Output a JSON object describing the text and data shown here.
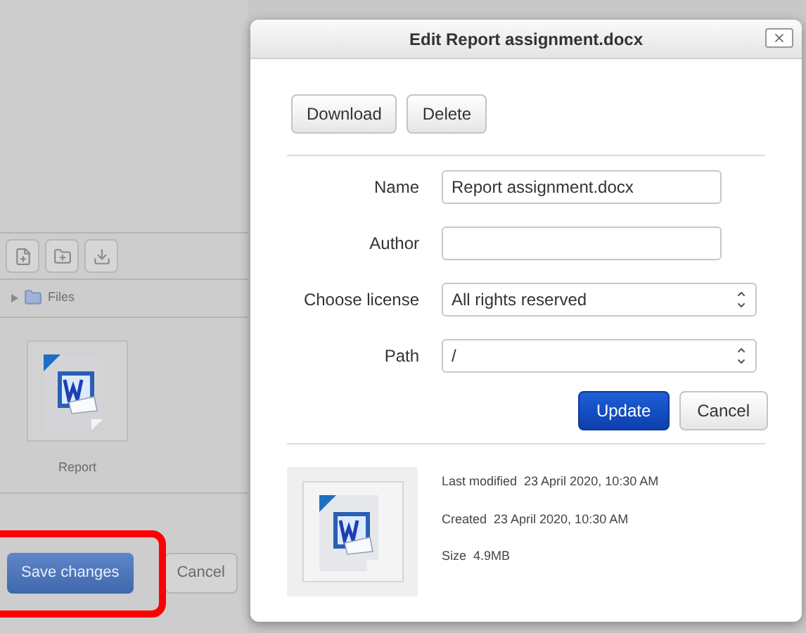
{
  "page": {
    "toolbar_icons": [
      {
        "kind": "file-plus"
      },
      {
        "kind": "folder-plus"
      },
      {
        "kind": "download"
      }
    ],
    "breadcrumb": "Files",
    "files": [
      {
        "name": "Report"
      }
    ],
    "buttons": [
      {
        "label": "Save changes",
        "kind": "primary"
      },
      {
        "label": "Cancel",
        "kind": "secondary"
      }
    ],
    "highlight_annotation": true
  },
  "dialog": {
    "title": "Edit Report assignment.docx",
    "actions": [
      "Download",
      "Delete"
    ],
    "fields": [
      {
        "label": "Name",
        "kind": "text",
        "value": "Report assignment.docx"
      },
      {
        "label": "Author",
        "kind": "text"
      },
      {
        "label": "Choose license",
        "kind": "select",
        "value": "All rights reserved"
      },
      {
        "label": "Path",
        "kind": "select",
        "value": "/"
      }
    ],
    "buttons": [
      {
        "label": "Update",
        "kind": "primary"
      },
      {
        "label": "Cancel",
        "kind": "secondary"
      }
    ],
    "details": [
      "Last modified  23 April 2020, 10:30 AM",
      "Created  23 April 2020, 10:30 AM",
      "Size  4.9MB"
    ]
  }
}
